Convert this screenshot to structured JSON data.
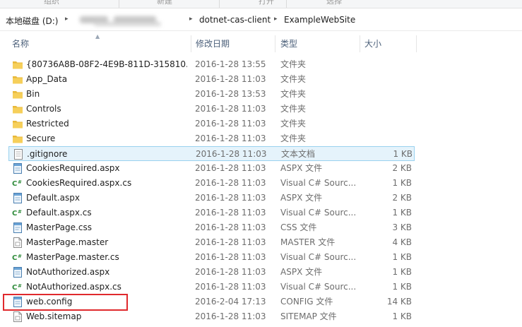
{
  "ribbon": {
    "labels": [
      "组织",
      "新建",
      "打开",
      "选择"
    ]
  },
  "address": {
    "root": "本地磁盘 (D:)",
    "crumbs": [
      "dotnet-cas-client",
      "ExampleWebSite"
    ]
  },
  "columns": {
    "name": "名称",
    "date": "修改日期",
    "type": "类型",
    "size": "大小"
  },
  "files": [
    {
      "name": "{80736A8B-08F2-4E9B-811D-315810...",
      "date": "2016-1-28 13:55",
      "type": "文件夹",
      "size": "",
      "icon": "folder-icon"
    },
    {
      "name": "App_Data",
      "date": "2016-1-28 11:03",
      "type": "文件夹",
      "size": "",
      "icon": "folder-icon"
    },
    {
      "name": "Bin",
      "date": "2016-1-28 13:53",
      "type": "文件夹",
      "size": "",
      "icon": "folder-icon"
    },
    {
      "name": "Controls",
      "date": "2016-1-28 11:03",
      "type": "文件夹",
      "size": "",
      "icon": "folder-icon"
    },
    {
      "name": "Restricted",
      "date": "2016-1-28 11:03",
      "type": "文件夹",
      "size": "",
      "icon": "folder-icon"
    },
    {
      "name": "Secure",
      "date": "2016-1-28 11:03",
      "type": "文件夹",
      "size": "",
      "icon": "folder-icon"
    },
    {
      "name": ".gitignore",
      "date": "2016-1-28 11:03",
      "type": "文本文档",
      "size": "1 KB",
      "icon": "text-file-icon",
      "selected": true
    },
    {
      "name": "CookiesRequired.aspx",
      "date": "2016-1-28 11:03",
      "type": "ASPX 文件",
      "size": "2 KB",
      "icon": "aspx-file-icon"
    },
    {
      "name": "CookiesRequired.aspx.cs",
      "date": "2016-1-28 11:03",
      "type": "Visual C# Sourc...",
      "size": "1 KB",
      "icon": "csharp-file-icon"
    },
    {
      "name": "Default.aspx",
      "date": "2016-1-28 11:03",
      "type": "ASPX 文件",
      "size": "2 KB",
      "icon": "aspx-file-icon"
    },
    {
      "name": "Default.aspx.cs",
      "date": "2016-1-28 11:03",
      "type": "Visual C# Sourc...",
      "size": "1 KB",
      "icon": "csharp-file-icon"
    },
    {
      "name": "MasterPage.css",
      "date": "2016-1-28 11:03",
      "type": "CSS 文件",
      "size": "3 KB",
      "icon": "css-file-icon"
    },
    {
      "name": "MasterPage.master",
      "date": "2016-1-28 11:03",
      "type": "MASTER 文件",
      "size": "4 KB",
      "icon": "generic-file-icon"
    },
    {
      "name": "MasterPage.master.cs",
      "date": "2016-1-28 11:03",
      "type": "Visual C# Sourc...",
      "size": "1 KB",
      "icon": "csharp-file-icon"
    },
    {
      "name": "NotAuthorized.aspx",
      "date": "2016-1-28 11:03",
      "type": "ASPX 文件",
      "size": "1 KB",
      "icon": "aspx-file-icon"
    },
    {
      "name": "NotAuthorized.aspx.cs",
      "date": "2016-1-28 11:03",
      "type": "Visual C# Sourc...",
      "size": "1 KB",
      "icon": "csharp-file-icon"
    },
    {
      "name": "web.config",
      "date": "2016-2-04 17:13",
      "type": "CONFIG 文件",
      "size": "14 KB",
      "icon": "config-file-icon",
      "highlighted": true
    },
    {
      "name": "Web.sitemap",
      "date": "2016-1-28 11:03",
      "type": "SITEMAP 文件",
      "size": "1 KB",
      "icon": "generic-file-icon"
    }
  ],
  "colors": {
    "highlight_border": "#e0292d",
    "selection_bg": "#e5f3fb",
    "selection_border": "#99d1ef",
    "folder": "#e8b83a"
  }
}
